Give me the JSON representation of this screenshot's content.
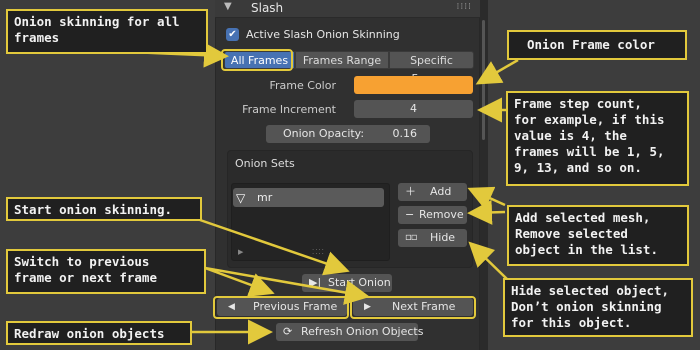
{
  "panel": {
    "header_title": "Slash",
    "active_checkbox_label": "Active Slash Onion Skinning",
    "active_checkbox_checked": true,
    "mode_tabs": [
      {
        "label": "All Frames",
        "active": true
      },
      {
        "label": "Frames Range",
        "active": false
      },
      {
        "label": "Specific Frames",
        "active": false
      }
    ],
    "frame_color_label": "Frame Color",
    "frame_color_value": "#f7a132",
    "frame_increment_label": "Frame Increment",
    "frame_increment_value": "4",
    "onion_opacity_label": "Onion Opacity:",
    "onion_opacity_value": "0.16",
    "onion_sets_title": "Onion Sets",
    "onion_sets_items": [
      {
        "label": "mr"
      }
    ],
    "add_label": "Add",
    "remove_label": "Remove",
    "hide_label": "Hide",
    "start_onion_label": "Start Onion",
    "previous_frame_label": "Previous Frame",
    "next_frame_label": "Next Frame",
    "refresh_label": "Refresh Onion Objects"
  },
  "annotations": {
    "all_frames": "Onion skinning for all\nframes",
    "start": "Start onion skinning.",
    "switch": "Switch to previous\nframe or next frame",
    "redraw": "Redraw onion objects",
    "color": "Onion Frame color",
    "step": "Frame step count,\nfor example, if this\nvalue is 4, the\nframes will be 1, 5,\n9, 13, and so on.",
    "add_remove": "Add selected mesh,\nRemove selected\nobject in the list.",
    "hide": "Hide selected object,\nDon’t onion skinning\nfor this object."
  },
  "colors": {
    "annotation_border": "#e2c93c",
    "accent_blue": "#4772b3",
    "frame_color": "#f7a132"
  }
}
